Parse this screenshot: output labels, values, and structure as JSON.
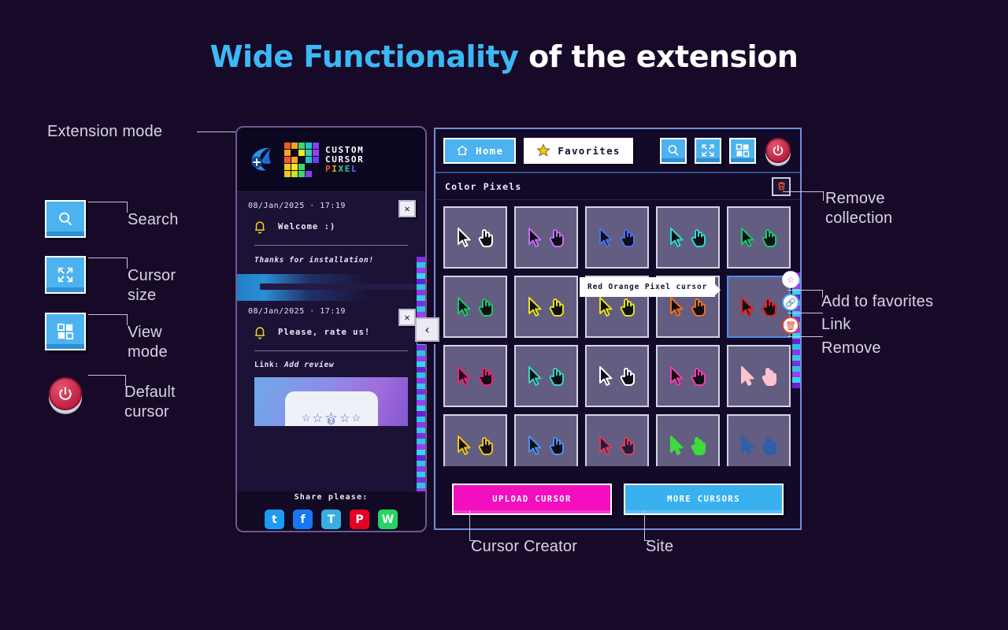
{
  "title": {
    "accent": "Wide Functionality",
    "plain": " of the extension"
  },
  "annotations": {
    "extension_mode": "Extension mode",
    "search": "Search",
    "cursor_size": "Cursor\nsize",
    "view_mode": "View\nmode",
    "default_cursor": "Default\ncursor",
    "remove_collection": "Remove\ncollection",
    "add_to_favorites": "Add to favorites",
    "link": "Link",
    "remove": "Remove",
    "cursor_creator": "Cursor Creator",
    "site": "Site"
  },
  "extension": {
    "logo": {
      "line1": "CUSTOM",
      "line2": "CURSOR",
      "line3": "PIXEL"
    },
    "moon_icon": "moon-plus-icon",
    "notifications": [
      {
        "date": "08/Jan/2025 · 17:19",
        "title": "Welcome :)",
        "icon": "bell-icon",
        "close": "✕",
        "subtitle": "Thanks for installation!"
      },
      {
        "date": "08/Jan/2025 · 17:19",
        "title": "Please, rate us!",
        "icon": "bell-icon",
        "close": "✕",
        "link_label": "Link:",
        "link_text": "Add review"
      }
    ],
    "share": {
      "title": "Share please:",
      "networks": [
        {
          "name": "twitter",
          "glyph": "t",
          "color": "#1d9bf0"
        },
        {
          "name": "facebook",
          "glyph": "f",
          "color": "#1877f2"
        },
        {
          "name": "telegram",
          "glyph": "T",
          "color": "#37aee2"
        },
        {
          "name": "pinterest",
          "glyph": "P",
          "color": "#e60023"
        },
        {
          "name": "whatsapp",
          "glyph": "W",
          "color": "#25d366"
        }
      ]
    },
    "collapse_glyph": "‹"
  },
  "main": {
    "tabs": [
      {
        "label": "Home",
        "icon": "home-icon",
        "active": false
      },
      {
        "label": "Favorites",
        "icon": "star-icon",
        "active": true
      }
    ],
    "tools": [
      {
        "name": "search-icon"
      },
      {
        "name": "cursor-size-icon"
      },
      {
        "name": "view-mode-icon"
      },
      {
        "name": "default-cursor-icon"
      }
    ],
    "collection": {
      "title": "Color Pixels",
      "remove_icon": "trash-icon"
    },
    "tooltip": "Red Orange Pixel cursor",
    "hover_actions": [
      {
        "name": "add-to-favorites-icon",
        "glyph": "☆"
      },
      {
        "name": "link-icon",
        "glyph": "🔗"
      },
      {
        "name": "remove-icon",
        "glyph": "🗑"
      }
    ],
    "footer_buttons": [
      {
        "label": "UPLOAD CURSOR",
        "color": "#f30ec0"
      },
      {
        "label": "MORE CURSORS",
        "color": "#39b1ef"
      }
    ]
  },
  "cursor_grid": {
    "columns": 5,
    "rows": 4,
    "cells": [
      {
        "color": "#ffffff",
        "fill": "#0e0e14",
        "selected": false
      },
      {
        "color": "#c46ef0",
        "fill": "#0e0e14",
        "selected": false
      },
      {
        "color": "#4d6ef5",
        "fill": "#0e0e14",
        "selected": false
      },
      {
        "color": "#2fd9cf",
        "fill": "#0e0e14",
        "selected": false
      },
      {
        "color": "#19c96b",
        "fill": "#0e0e14",
        "selected": false
      },
      {
        "color": "#19c96b",
        "fill": "#0e0e14",
        "selected": false
      },
      {
        "color": "#e8e219",
        "fill": "#0e0e14",
        "selected": false
      },
      {
        "color": "#e8e219",
        "fill": "#0e0e14",
        "selected": false
      },
      {
        "color": "#f07020",
        "fill": "#0e0e14",
        "selected": false
      },
      {
        "color": "#e02020",
        "fill": "#0e0e14",
        "selected": true
      },
      {
        "color": "#f01f7a",
        "fill": "#0e0e14",
        "selected": false
      },
      {
        "color": "#36d6c0",
        "fill": "#0e0e14",
        "selected": false
      },
      {
        "color": "#ffffff",
        "fill": "#0e0e14",
        "selected": false
      },
      {
        "color": "#f23bb0",
        "fill": "#0e0e14",
        "selected": false
      },
      {
        "color": "#ffc3d0",
        "fill": "#ffc3d0",
        "selected": false
      },
      {
        "color": "#f0c419",
        "fill": "#0e0e14",
        "selected": false
      },
      {
        "color": "#4d8ef0",
        "fill": "#0e0e14",
        "selected": false
      },
      {
        "color": "#e03a5a",
        "fill": "#221b3c",
        "selected": false
      },
      {
        "color": "#3ddb3d",
        "fill": "#3ddb3d",
        "selected": false
      },
      {
        "color": "#2e5fa8",
        "fill": "#2e5fa8",
        "selected": false
      }
    ]
  },
  "scrollbar_colors": [
    "#7d2fe0",
    "#2fc4e0",
    "#9b3df0",
    "#35d6e8",
    "#6a20d4",
    "#2fc4e0",
    "#8f35ea",
    "#34c9e6"
  ]
}
